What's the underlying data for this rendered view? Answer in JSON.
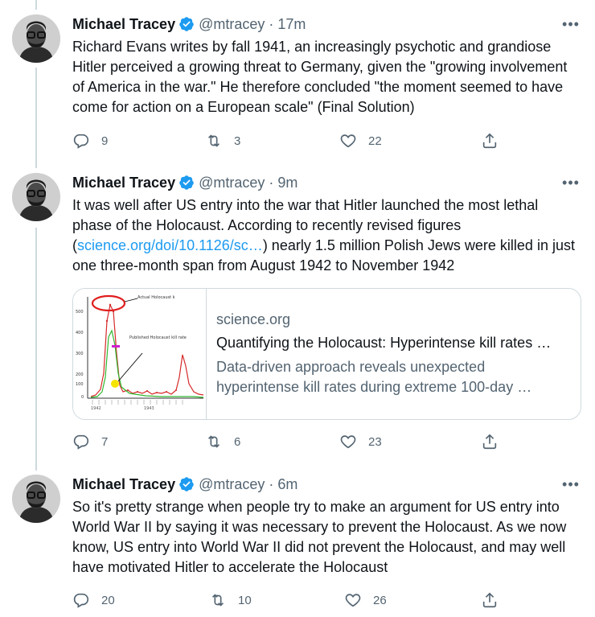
{
  "tweets": [
    {
      "name": "Michael Tracey",
      "handle": "@mtracey",
      "time": "· 17m",
      "text": "Richard Evans writes by fall 1941, an increasingly psychotic and grandiose Hitler perceived a growing threat to Germany, given the \"growing involvement of America in the war.\" He therefore concluded \"the moment seemed to have come for action on a European scale\" (Final Solution)",
      "replies": "9",
      "retweets": "3",
      "likes": "22"
    },
    {
      "name": "Michael Tracey",
      "handle": "@mtracey",
      "time": "· 9m",
      "text_before": "It was well after US entry into the war that Hitler launched the most lethal phase of the Holocaust. According to recently revised figures (",
      "link": "science.org/doi/10.1126/sc…",
      "text_after": ") nearly 1.5 million Polish Jews were killed in just one three-month span from August 1942 to November 1942",
      "card": {
        "domain": "science.org",
        "title": "Quantifying the Holocaust: Hyperintense kill rates …",
        "description": "Data-driven approach reveals unexpected hyperintense kill rates during extreme 100-day …",
        "chart_labels": {
          "actual": "Actual Holocaust k",
          "published": "Published Holocaust kill rate",
          "y_ticks": [
            "500",
            "400",
            "300",
            "200",
            "100",
            "0"
          ],
          "year_1942": "1942",
          "year_1943": "1943"
        }
      },
      "replies": "7",
      "retweets": "6",
      "likes": "23"
    },
    {
      "name": "Michael Tracey",
      "handle": "@mtracey",
      "time": "· 6m",
      "text": "So it's pretty strange when people try to make an argument for US entry into World War II by saying it was necessary to prevent the Holocaust. As we now know, US entry into World War II did not prevent the Holocaust, and may well have motivated Hitler to accelerate the Holocaust",
      "replies": "20",
      "retweets": "10",
      "likes": "26"
    }
  ],
  "more_label": "•••",
  "colors": {
    "accent": "#1d9bf0",
    "secondary_text": "#536471",
    "border": "#cfd9de"
  }
}
